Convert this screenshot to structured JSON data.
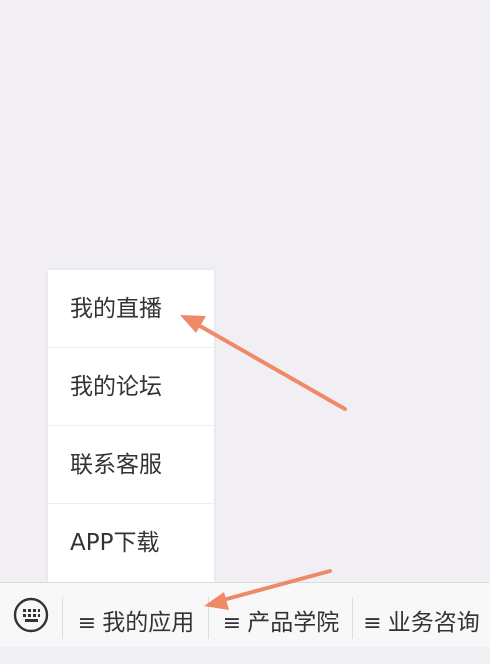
{
  "popup_menu": {
    "items": [
      {
        "label": "我的直播"
      },
      {
        "label": "我的论坛"
      },
      {
        "label": "联系客服"
      },
      {
        "label": "APP下载"
      }
    ]
  },
  "bottom_bar": {
    "keyboard_icon": "keyboard-icon",
    "menu_glyph": "≡",
    "tabs": [
      {
        "label": "我的应用"
      },
      {
        "label": "产品学院"
      },
      {
        "label": "业务咨询"
      }
    ]
  },
  "colors": {
    "background": "#f1eff3",
    "menu_background": "#ffffff",
    "text": "#333333",
    "annotation_arrow": "#ef8a68"
  }
}
